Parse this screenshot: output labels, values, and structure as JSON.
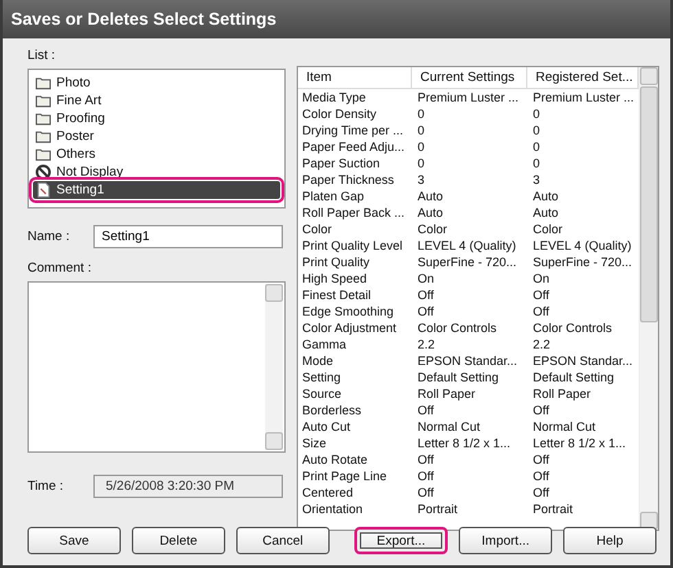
{
  "window": {
    "title": "Saves or Deletes Select Settings"
  },
  "list": {
    "label": "List :",
    "items": [
      {
        "name": "Photo",
        "kind": "folder",
        "selected": false,
        "callout": false
      },
      {
        "name": "Fine Art",
        "kind": "folder",
        "selected": false,
        "callout": false
      },
      {
        "name": "Proofing",
        "kind": "folder",
        "selected": false,
        "callout": false
      },
      {
        "name": "Poster",
        "kind": "folder",
        "selected": false,
        "callout": false
      },
      {
        "name": "Others",
        "kind": "folder",
        "selected": false,
        "callout": false
      },
      {
        "name": "Not Display",
        "kind": "hidden",
        "selected": false,
        "callout": false
      },
      {
        "name": "Setting1",
        "kind": "setting",
        "selected": true,
        "callout": true
      }
    ]
  },
  "name_field": {
    "label": "Name :",
    "value": "Setting1"
  },
  "comment_field": {
    "label": "Comment :"
  },
  "time_field": {
    "label": "Time :",
    "value": "5/26/2008 3:20:30 PM"
  },
  "table": {
    "columns": [
      "Item",
      "Current Settings",
      "Registered Set..."
    ],
    "rows": [
      [
        "Media Type",
        "Premium Luster ...",
        "Premium Luster ..."
      ],
      [
        "Color Density",
        "0",
        "0"
      ],
      [
        "Drying Time per ...",
        "0",
        "0"
      ],
      [
        "Paper Feed Adju...",
        "0",
        "0"
      ],
      [
        "Paper Suction",
        "0",
        "0"
      ],
      [
        "Paper Thickness",
        "3",
        "3"
      ],
      [
        "Platen Gap",
        "Auto",
        "Auto"
      ],
      [
        "Roll Paper Back ...",
        "Auto",
        "Auto"
      ],
      [
        "Color",
        "Color",
        "Color"
      ],
      [
        "Print Quality Level",
        "LEVEL 4 (Quality)",
        "LEVEL 4 (Quality)"
      ],
      [
        "Print Quality",
        "SuperFine - 720...",
        "SuperFine - 720..."
      ],
      [
        "High Speed",
        "On",
        "On"
      ],
      [
        "Finest Detail",
        "Off",
        "Off"
      ],
      [
        "Edge Smoothing",
        "Off",
        "Off"
      ],
      [
        "Color Adjustment",
        "Color Controls",
        "Color Controls"
      ],
      [
        "Gamma",
        "2.2",
        "2.2"
      ],
      [
        "Mode",
        "EPSON Standar...",
        "EPSON Standar..."
      ],
      [
        "Setting",
        "Default Setting",
        "Default Setting"
      ],
      [
        "Source",
        "Roll Paper",
        "Roll Paper"
      ],
      [
        "Borderless",
        "Off",
        "Off"
      ],
      [
        "Auto Cut",
        "Normal Cut",
        "Normal Cut"
      ],
      [
        "Size",
        "Letter 8 1/2 x 1...",
        "Letter 8 1/2 x 1..."
      ],
      [
        "Auto Rotate",
        "Off",
        "Off"
      ],
      [
        "Print Page Line",
        "Off",
        "Off"
      ],
      [
        "Centered",
        "Off",
        "Off"
      ],
      [
        "Orientation",
        "Portrait",
        "Portrait"
      ]
    ]
  },
  "buttons": [
    {
      "label": "Save",
      "callout": false
    },
    {
      "label": "Delete",
      "callout": false
    },
    {
      "label": "Cancel",
      "callout": false
    },
    {
      "label": "Export...",
      "callout": true
    },
    {
      "label": "Import...",
      "callout": false
    },
    {
      "label": "Help",
      "callout": false
    }
  ]
}
